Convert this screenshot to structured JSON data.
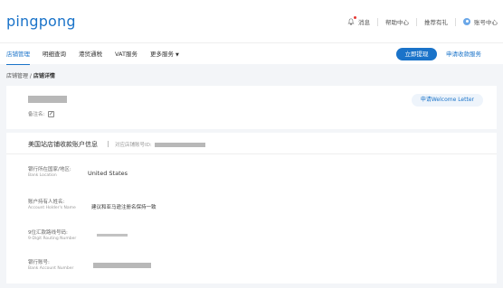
{
  "header": {
    "logo": "pingpong",
    "messages": "消息",
    "help": "帮助中心",
    "referral": "推荐有礼",
    "account": "账号中心"
  },
  "nav": {
    "items": [
      "店铺管理",
      "明细查询",
      "港贸通税",
      "VAT服务",
      "更多服务"
    ],
    "withdraw_button": "立即提现",
    "apply_account": "申请收款服务"
  },
  "breadcrumb": {
    "parent": "店铺管理",
    "separator": " / ",
    "current": "店铺详情"
  },
  "store": {
    "remark_label": "备注名:",
    "welcome_letter": "申请Welcome Letter"
  },
  "account_section": {
    "title": "美国站店铺收款账户信息",
    "store_id_label": "对应店铺账号ID:",
    "fields": [
      {
        "label": "银行所在国家/地区:",
        "en": "Bank Location",
        "value": "United States"
      },
      {
        "label": "账户持有人姓名:",
        "en": "Account Holder's Name",
        "value": "建议和亚马逊注册名保持一致"
      },
      {
        "label": "9位汇款路线号码:",
        "en": "9-Digit Routing Number",
        "value": ""
      },
      {
        "label": "银行账号:",
        "en": "Bank Account Number",
        "value": ""
      }
    ]
  },
  "colors": {
    "brand": "#1a73c9",
    "background": "#f3f5f8",
    "redaction": "#b8b8b8"
  }
}
